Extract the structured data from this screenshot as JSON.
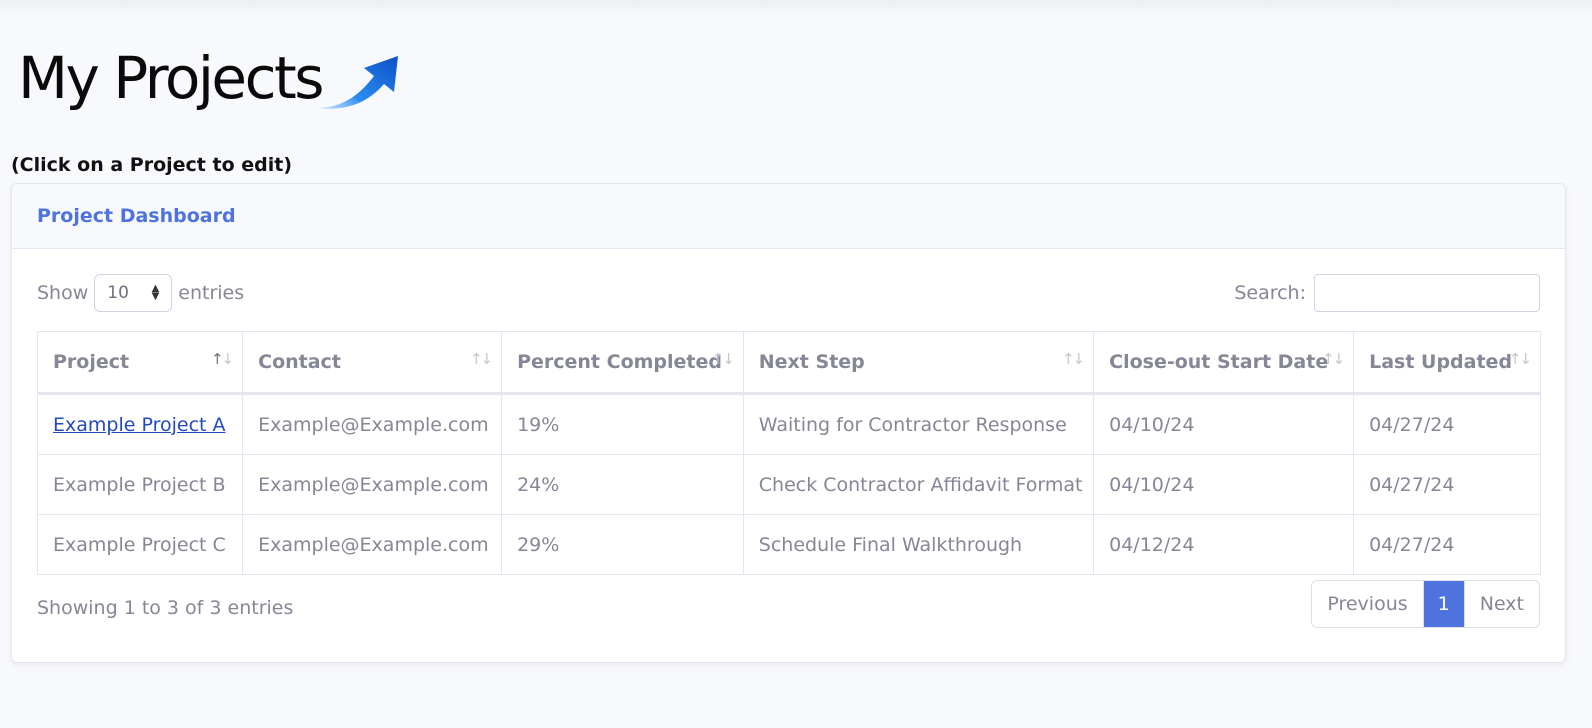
{
  "brand": {
    "logo_text": "My Projects",
    "arrow_color": "#1e78e0"
  },
  "hint": "(Click on a Project to edit)",
  "card": {
    "title": "Project Dashboard"
  },
  "length_control": {
    "label_before": "Show",
    "selected": "10",
    "label_after": "entries"
  },
  "search": {
    "label": "Search:",
    "value": ""
  },
  "table": {
    "columns": [
      "Project",
      "Contact",
      "Percent Completed",
      "Next Step",
      "Close-out Start Date",
      "Last Updated"
    ],
    "sorted_column": "Project",
    "rows": [
      [
        "Example Project A",
        "Example@Example.com",
        "19%",
        "Waiting for Contractor Response",
        "04/10/24",
        "04/27/24"
      ],
      [
        "Example Project B",
        "Example@Example.com",
        "24%",
        "Check Contractor Affidavit Format",
        "04/10/24",
        "04/27/24"
      ],
      [
        "Example Project C",
        "Example@Example.com",
        "29%",
        "Schedule Final Walkthrough",
        "04/12/24",
        "04/27/24"
      ]
    ]
  },
  "info": "Showing 1 to 3 of 3 entries",
  "pagination": {
    "previous": "Previous",
    "current": "1",
    "next": "Next"
  },
  "colors": {
    "accent": "#4e73df",
    "link": "#224abe",
    "text_muted": "#858796"
  }
}
